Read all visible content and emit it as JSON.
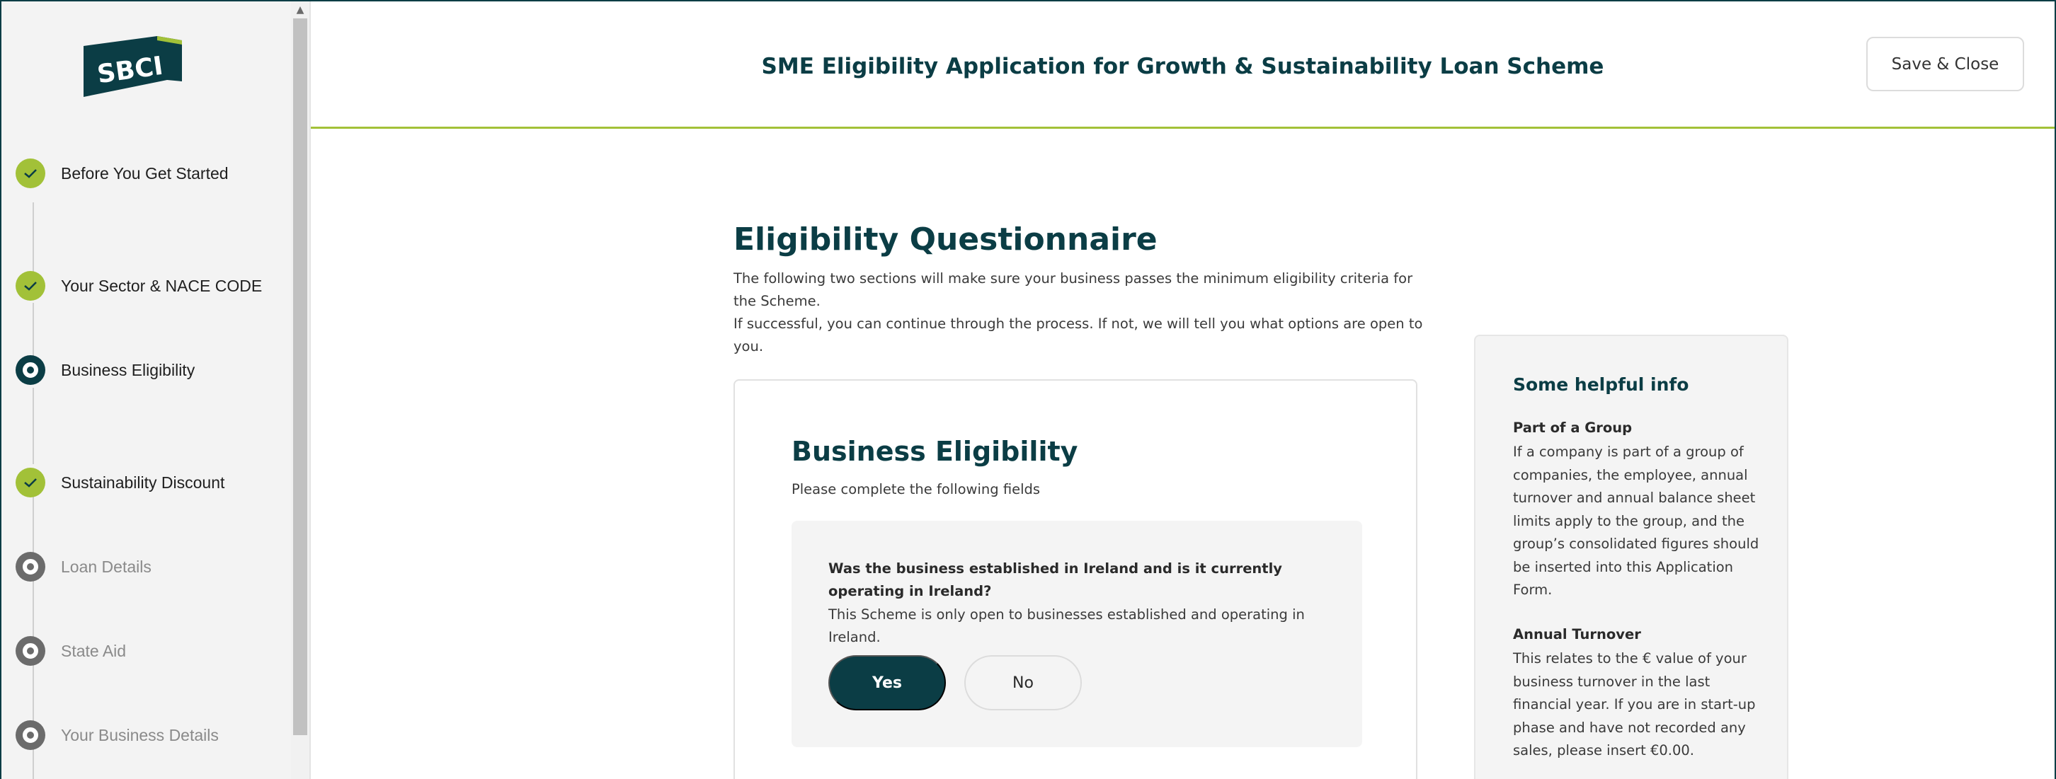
{
  "header": {
    "title": "SME Eligibility Application for Growth & Sustainability Loan Scheme",
    "save_label": "Save & Close"
  },
  "brand": {
    "logo_text": "SBCI",
    "accent": "#a2c138",
    "primary": "#0b3d45"
  },
  "sidebar": {
    "steps": [
      {
        "label": "Before You Get Started",
        "status": "done",
        "icon": "check-icon"
      },
      {
        "label": "Your Sector & NACE CODE",
        "status": "done",
        "icon": "check-icon"
      },
      {
        "label": "Business Eligibility",
        "status": "current",
        "icon": "current-step-icon"
      },
      {
        "label": "Sustainability Discount",
        "status": "done",
        "icon": "check-icon"
      },
      {
        "label": "Loan Details",
        "status": "todo",
        "icon": "pending-step-icon"
      },
      {
        "label": "State Aid",
        "status": "todo",
        "icon": "pending-step-icon"
      },
      {
        "label": "Your Business Details",
        "status": "todo",
        "icon": "pending-step-icon"
      }
    ]
  },
  "main": {
    "heading": "Eligibility Questionnaire",
    "intro_1": "The following two sections will make sure your business passes the minimum eligibility criteria for the Scheme.",
    "intro_2": "If successful, you can continue through the process. If not, we will tell you what options are open to you.",
    "card": {
      "title": "Business Eligibility",
      "subtitle": "Please complete the following fields",
      "question": "Was the business established in Ireland and is it currently operating in Ireland?",
      "help": "This Scheme is only open to businesses established and operating in Ireland.",
      "yes_label": "Yes",
      "no_label": "No",
      "selected": "Yes"
    }
  },
  "info": {
    "title": "Some helpful info",
    "sections": [
      {
        "title": "Part of a Group",
        "body": "If a company is part of a group of companies, the employee, annual turnover and annual balance sheet limits apply to the group, and the group’s consolidated figures should be inserted into this Application Form."
      },
      {
        "title": "Annual Turnover",
        "body": "This relates to the € value of your business turnover in the last financial year. If you are in start-up phase and have not recorded any sales, please insert €0.00."
      }
    ]
  }
}
